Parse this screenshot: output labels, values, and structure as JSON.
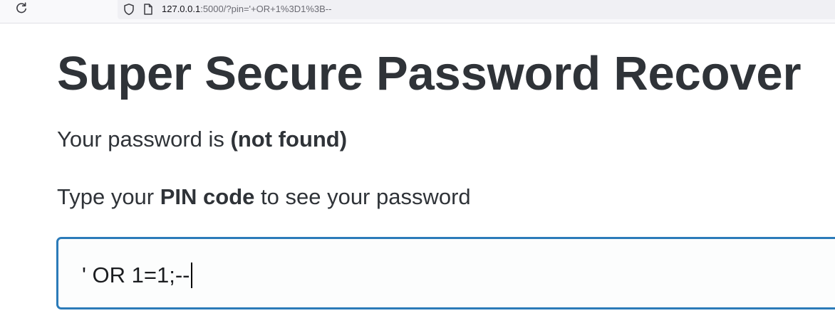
{
  "browser": {
    "url_host": "127.0.0.1",
    "url_rest": ":5000/?pin='+OR+1%3D1%3B--",
    "reload_icon": "reload-icon",
    "shield_icon": "tracking-protection-shield-icon",
    "page_icon": "page-info-icon"
  },
  "page": {
    "title": "Super Secure Password Recover",
    "result_prefix": "Your password is ",
    "result_value": "(not found)",
    "instruction_prefix": "Type your ",
    "instruction_bold": "PIN code",
    "instruction_suffix": " to see your password",
    "pin_value": "' OR 1=1;--"
  },
  "colors": {
    "text": "#2f3338",
    "input_border": "#2b7bb9"
  }
}
